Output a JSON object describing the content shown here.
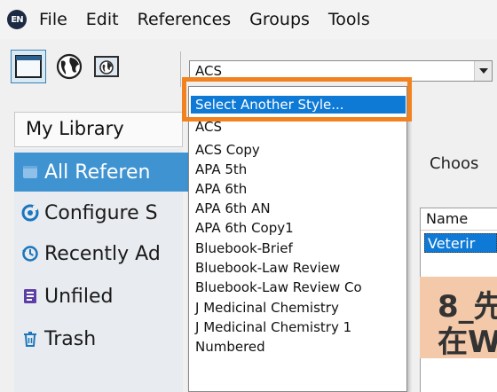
{
  "menubar": {
    "logo": "EN",
    "items": [
      "File",
      "Edit",
      "References",
      "Groups",
      "Tools"
    ]
  },
  "toolbar": {
    "icons": [
      "local-library-icon",
      "online-search-icon",
      "online-library-icon"
    ],
    "style_value": "ACS"
  },
  "dropdown": {
    "highlighted": "Select Another Style...",
    "items": [
      "ACS",
      "ACS Copy",
      "APA 5th",
      "APA 6th",
      "APA 6th AN",
      "APA 6th Copy1",
      "Bluebook-Brief",
      "Bluebook-Law Review",
      "Bluebook-Law Review Co",
      "J Medicinal Chemistry",
      "J Medicinal Chemistry 1",
      "Numbered"
    ]
  },
  "library": {
    "selector_label": "My Library",
    "items": [
      {
        "label": "All Referen",
        "icon": "all-references-icon"
      },
      {
        "label": "Configure S",
        "icon": "sync-icon"
      },
      {
        "label": "Recently Ad",
        "icon": "history-icon"
      },
      {
        "label": "Unfiled",
        "icon": "unfiled-icon"
      },
      {
        "label": "Trash",
        "icon": "trash-icon"
      }
    ]
  },
  "chooser": {
    "prompt": "Choos",
    "column_header": "Name",
    "selected_row": "Veterir"
  },
  "annotation": {
    "line1": "8_先",
    "line2": "在W"
  },
  "colors": {
    "highlight": "#0f7ad6",
    "sidebar_selected": "#3f93d1",
    "annotation_border": "#f2821e",
    "annotation_fill": "#f4c9a9"
  }
}
